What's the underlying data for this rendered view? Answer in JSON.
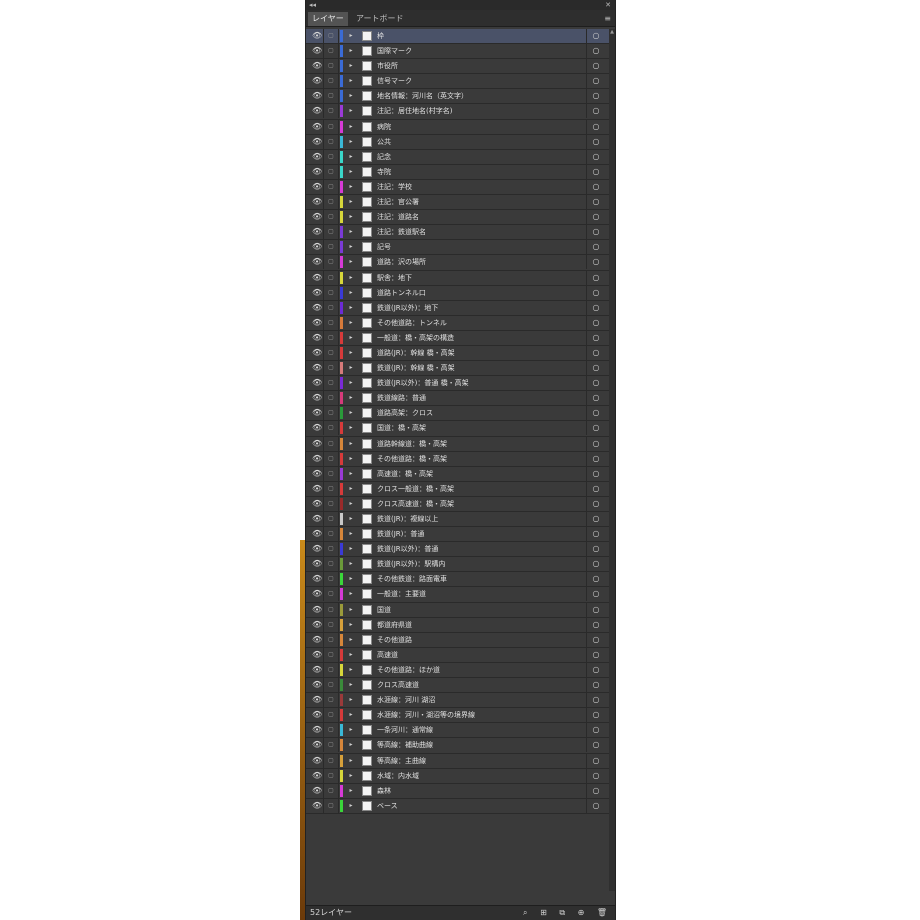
{
  "panel": {
    "tabs": [
      "レイヤー",
      "アートボード"
    ],
    "collapse_glyph": "◂◂",
    "close_glyph": "✕",
    "menu_glyph": "≡",
    "layer_count": "52レイヤー"
  },
  "icons": {
    "eye": "👁",
    "lock": "▢",
    "arrow": "▸",
    "target": "○"
  },
  "footer_icons": [
    "⌕",
    "⊞",
    "⧉",
    "⊕",
    "🗑"
  ],
  "layers": [
    {
      "name": "枠",
      "color": "#3a6bd6",
      "selected": true
    },
    {
      "name": "国際マーク",
      "color": "#3a6bd6"
    },
    {
      "name": "市役所",
      "color": "#3a6bd6"
    },
    {
      "name": "信号マーク",
      "color": "#3a6bd6"
    },
    {
      "name": "地名情報：河川名（英文字）",
      "color": "#3a6bd6"
    },
    {
      "name": "注記：居住地名(村字名)",
      "color": "#9a3ad6"
    },
    {
      "name": "病院",
      "color": "#d63ad6"
    },
    {
      "name": "公共",
      "color": "#3ab8d6"
    },
    {
      "name": "記念",
      "color": "#3ad6c8"
    },
    {
      "name": "寺院",
      "color": "#3ad6c8"
    },
    {
      "name": "注記：学校",
      "color": "#d63ad6"
    },
    {
      "name": "注記：官公署",
      "color": "#d6d63a"
    },
    {
      "name": "注記：道路名",
      "color": "#d6d63a"
    },
    {
      "name": "注記：鉄道駅名",
      "color": "#7a3ad6"
    },
    {
      "name": "記号",
      "color": "#7a3ad6"
    },
    {
      "name": "道路：沢の場所",
      "color": "#d63ad6"
    },
    {
      "name": "駅舎：地下",
      "color": "#d6d63a"
    },
    {
      "name": "道路トンネル口",
      "color": "#3a3ad6"
    },
    {
      "name": "鉄道(JR以外)：地下",
      "color": "#6b2ad6"
    },
    {
      "name": "その他道路：トンネル",
      "color": "#d67a3a"
    },
    {
      "name": "一般道：橋・高架の構造",
      "color": "#d63a3a"
    },
    {
      "name": "道路(JR)：幹線 橋・高架",
      "color": "#d63a3a"
    },
    {
      "name": "鉄道(JR)：幹線 橋・高架",
      "color": "#d67a7a"
    },
    {
      "name": "鉄道(JR以外)：普通 橋・高架",
      "color": "#7a2ad6"
    },
    {
      "name": "鉄道線路：普通",
      "color": "#d63a7a"
    },
    {
      "name": "道路高架：クロス",
      "color": "#2a9a3a"
    },
    {
      "name": "国道：橋・高架",
      "color": "#d63a3a"
    },
    {
      "name": "道路幹線道：橋・高架",
      "color": "#d6863a"
    },
    {
      "name": "その他道路：橋・高架",
      "color": "#d63a3a"
    },
    {
      "name": "高速道：橋・高架",
      "color": "#9a3ad6"
    },
    {
      "name": "クロス一般道：橋・高架",
      "color": "#d63a3a"
    },
    {
      "name": "クロス高速道：橋・高架",
      "color": "#9a2a2a"
    },
    {
      "name": "鉄道(JR)：複線以上",
      "color": "#c8c8c8"
    },
    {
      "name": "鉄道(JR)：普通",
      "color": "#d6863a"
    },
    {
      "name": "鉄道(JR以外)：普通",
      "color": "#3a3ad6"
    },
    {
      "name": "鉄道(JR以外)：駅構内",
      "color": "#6b9a3a"
    },
    {
      "name": "その他鉄道：路面電車",
      "color": "#3ad63a"
    },
    {
      "name": "一般道：主要道",
      "color": "#d63ad6"
    },
    {
      "name": "国道",
      "color": "#9a9a3a"
    },
    {
      "name": "都道府県道",
      "color": "#d6a03a"
    },
    {
      "name": "その他道路",
      "color": "#d6863a"
    },
    {
      "name": "高速道",
      "color": "#d63a3a"
    },
    {
      "name": "その他道路：ほか道",
      "color": "#d6d63a"
    },
    {
      "name": "クロス高速道",
      "color": "#3a8a3a"
    },
    {
      "name": "水涯線：河川 湖沼",
      "color": "#9a3a3a"
    },
    {
      "name": "水涯線：河川・湖沼等の境界線",
      "color": "#d63a3a"
    },
    {
      "name": "一条河川：通常線",
      "color": "#3ab8d6"
    },
    {
      "name": "等高線：補助曲線",
      "color": "#d6863a"
    },
    {
      "name": "等高線：主曲線",
      "color": "#d6a03a"
    },
    {
      "name": "水域：内水域",
      "color": "#d6d63a"
    },
    {
      "name": "森林",
      "color": "#d63ad6"
    },
    {
      "name": "ベース",
      "color": "#3ad63a"
    }
  ]
}
